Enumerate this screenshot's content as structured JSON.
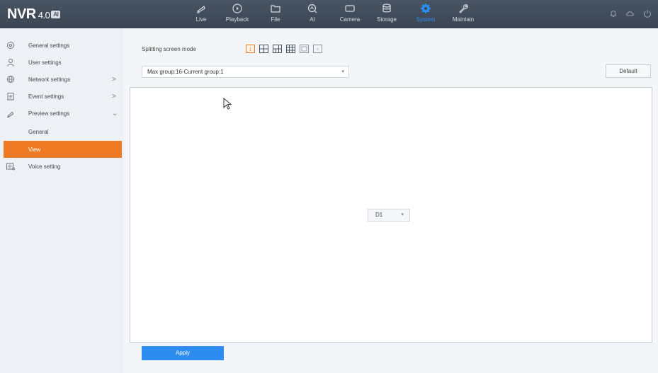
{
  "brand": {
    "name": "NVR",
    "version": "4.0",
    "badge": "AI"
  },
  "nav": [
    {
      "label": "Live",
      "icon": "live-icon"
    },
    {
      "label": "Playback",
      "icon": "playback-icon"
    },
    {
      "label": "File",
      "icon": "folder-icon"
    },
    {
      "label": "AI",
      "icon": "ai-icon"
    },
    {
      "label": "Camera",
      "icon": "camera-icon"
    },
    {
      "label": "Storage",
      "icon": "database-icon"
    },
    {
      "label": "System",
      "icon": "gear-icon",
      "active": true
    },
    {
      "label": "Maintain",
      "icon": "wrench-icon"
    }
  ],
  "sidebar": {
    "items": [
      {
        "label": "General settings",
        "icon": "settings-circle-icon"
      },
      {
        "label": "User settings",
        "icon": "user-icon"
      },
      {
        "label": "Network settings",
        "icon": "globe-icon",
        "arrow": ">"
      },
      {
        "label": "Event settings",
        "icon": "clipboard-icon",
        "arrow": ">"
      },
      {
        "label": "Preview settings",
        "icon": "preview-icon",
        "arrow": "⌄"
      },
      {
        "label": "General"
      },
      {
        "label": "View",
        "active": true
      },
      {
        "label": "Voice setting",
        "icon": "voice-icon"
      }
    ]
  },
  "main": {
    "splitting_label": "Splitting screen mode",
    "group_select": "Max group:16-Current group:1",
    "default_button": "Default",
    "channel_select": "D1",
    "apply_button": "Apply"
  },
  "colors": {
    "accent": "#2d8cf0",
    "active_sidebar": "#ee7a24",
    "topbar": "#434e5c"
  }
}
